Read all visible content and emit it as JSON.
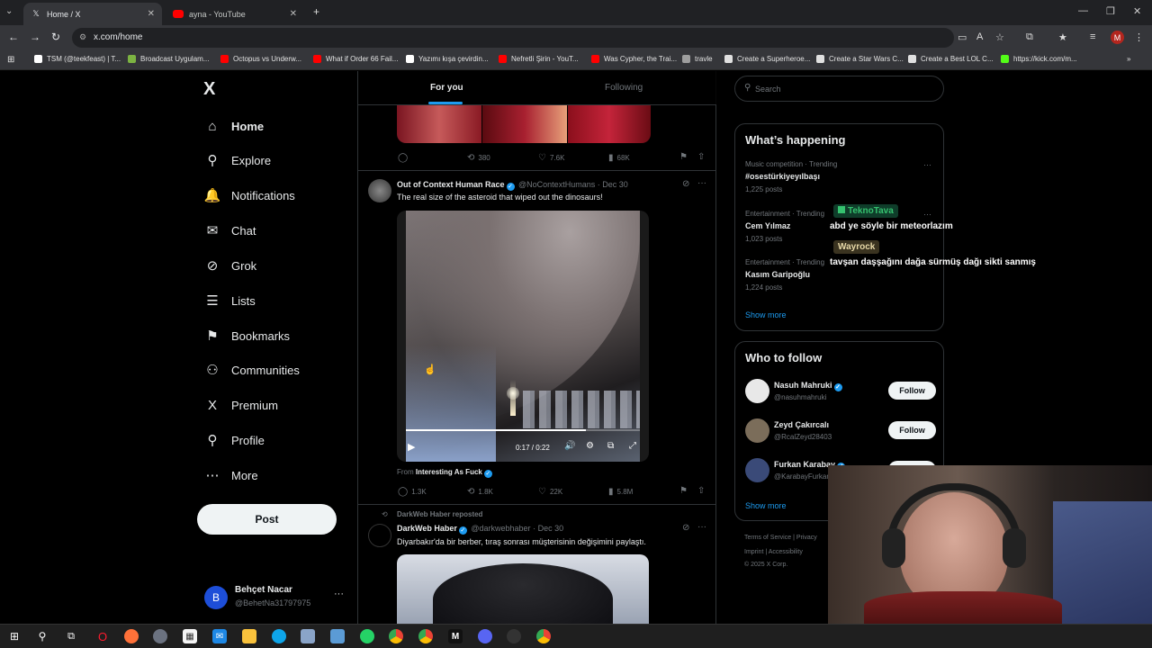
{
  "browser": {
    "tabs": [
      {
        "label": "Home / X",
        "active": true,
        "icon": "x-logo-icon"
      },
      {
        "label": "ayna - YouTube",
        "active": false,
        "icon": "youtube-icon"
      }
    ],
    "new_tab": "+",
    "url": "x.com/home",
    "bookmarks": [
      {
        "label": "TSM (@teekfeast) | T...",
        "color": "#ffffff"
      },
      {
        "label": "Broadcast Uygulam...",
        "color": "#7cb342"
      },
      {
        "label": "Octopus vs Underw...",
        "color": "#ff0000"
      },
      {
        "label": "What if Order 66 Fail...",
        "color": "#ff0000"
      },
      {
        "label": "Yazımı kışa çevirdin...",
        "color": "#ffffff"
      },
      {
        "label": "Nefretli Şirin - YouT...",
        "color": "#ff0000"
      },
      {
        "label": "Was Cypher, the Trai...",
        "color": "#ff0000"
      },
      {
        "label": "travle",
        "color": "#9e9e9e"
      },
      {
        "label": "Create a Superheroe...",
        "color": "#e0e0e0"
      },
      {
        "label": "Create a Star Wars C...",
        "color": "#e0e0e0"
      },
      {
        "label": "Create a Best LOL C...",
        "color": "#e0e0e0"
      },
      {
        "label": "https://kick.com/m...",
        "color": "#53fc18"
      }
    ],
    "profile_letter": "M"
  },
  "x": {
    "logo": "X",
    "nav": [
      {
        "label": "Home",
        "icon": "home-icon",
        "glyph": "⌂",
        "bold": true
      },
      {
        "label": "Explore",
        "icon": "search-icon",
        "glyph": "⚲"
      },
      {
        "label": "Notifications",
        "icon": "bell-icon",
        "glyph": "🔔"
      },
      {
        "label": "Chat",
        "icon": "mail-icon",
        "glyph": "✉"
      },
      {
        "label": "Grok",
        "icon": "grok-icon",
        "glyph": "⊘"
      },
      {
        "label": "Lists",
        "icon": "list-icon",
        "glyph": "☰"
      },
      {
        "label": "Bookmarks",
        "icon": "bookmark-icon",
        "glyph": "⚑"
      },
      {
        "label": "Communities",
        "icon": "people-icon",
        "glyph": "⚇"
      },
      {
        "label": "Premium",
        "icon": "x-premium-icon",
        "glyph": "X"
      },
      {
        "label": "Profile",
        "icon": "person-icon",
        "glyph": "⚲"
      },
      {
        "label": "More",
        "icon": "more-circle-icon",
        "glyph": "⋯"
      }
    ],
    "post_button": "Post",
    "account": {
      "name": "Behçet Nacar",
      "handle": "@BehetNa31797975",
      "initial": "B",
      "more": "···"
    },
    "timeline_tabs": {
      "for_you": "For you",
      "following": "Following"
    },
    "top_post_stats": {
      "reposts": "380",
      "likes": "7.6K",
      "views": "68K"
    },
    "tweet1": {
      "name": "Out of Context Human Race",
      "handle": "@NoContextHumans",
      "date": "· Dec 30",
      "text": "The real size of the asteroid that wiped out the dinosaurs!",
      "video_time": "0:17 / 0:22",
      "progress": 0.77,
      "from_label": "From",
      "from_source": "Interesting As Fuck",
      "stats": {
        "replies": "1.3K",
        "reposts": "1.8K",
        "likes": "22K",
        "views": "5.8M"
      }
    },
    "tweet2": {
      "reposted_by": "DarkWeb Haber reposted",
      "name": "DarkWeb Haber",
      "handle": "@darkwebhaber",
      "date": "· Dec 30",
      "text": "Diyarbakır'da bir berber, tıraş sonrası müşterisinin değişimini paylaştı."
    },
    "search_placeholder": "Search",
    "whats_happening": {
      "title": "What’s happening",
      "trends": [
        {
          "meta": "Music competition · Trending",
          "name": "#osestürkiyeyılbaşı",
          "posts": "1,225 posts"
        },
        {
          "meta": "Entertainment · Trending",
          "name": "Cem Yılmaz",
          "posts": "1,023 posts"
        },
        {
          "meta": "Entertainment · Trending",
          "name": "Kasım Garipoğlu",
          "posts": "1,224 posts"
        }
      ],
      "show_more": "Show more"
    },
    "who_to_follow": {
      "title": "Who to follow",
      "users": [
        {
          "name": "Nasuh Mahruki",
          "handle": "@nasuhmahruki",
          "button": "Follow"
        },
        {
          "name": "Zeyd Çakırcalı",
          "handle": "@RcalZeyd28403",
          "button": "Follow"
        },
        {
          "name": "Furkan Karabay",
          "handle": "@KarabayFurkan",
          "button": "Follow"
        }
      ],
      "show_more": "Show more"
    },
    "footer": {
      "terms": "Terms of Service",
      "privacy": "Privacy",
      "imprint": "Imprint",
      "accessibility": "Accessibility",
      "copyright": "© 2025 X Corp."
    }
  },
  "overlay_chat": [
    {
      "user": "TeknoTava",
      "message": "abd ye söyle bir meteorlazım",
      "color": "#35c26f"
    },
    {
      "user": "Wayrock",
      "message": "tavşan daşşağını dağa sürmüş dağı sikti sanmış",
      "color": "#e8d9a8"
    }
  ]
}
